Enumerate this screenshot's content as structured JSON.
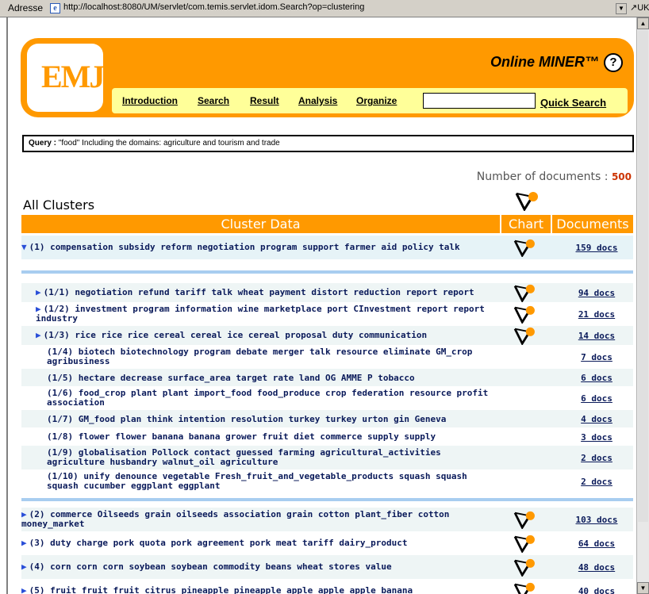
{
  "browser": {
    "address_label": "Adresse",
    "url": "http://localhost:8080/UM/servlet/com.temis.servlet.idom.Search?op=clustering",
    "go_label": "UK"
  },
  "header": {
    "logo_text": "EMJ",
    "app_title": "Online MINER™",
    "help_glyph": "?",
    "nav": [
      "Introduction",
      "Search",
      "Result",
      "Analysis",
      "Organize"
    ],
    "quick_search_placeholder": "",
    "quick_search_label": "Quick Search"
  },
  "query": {
    "label": "Query :",
    "text": " \"food\"  Including the domains: agriculture and tourism and trade"
  },
  "doc_count": {
    "label": "Number of documents : ",
    "value": "500"
  },
  "clusters_title": "All Clusters",
  "table": {
    "headers": [
      "Cluster Data",
      "Chart",
      "Documents"
    ],
    "top": {
      "arrow": "▼",
      "text": "(1) compensation subsidy reform negotiation program support farmer aid policy talk",
      "docs": "159 docs",
      "chart": true
    },
    "sub": [
      {
        "arrow": "▶",
        "text": "(1/1) negotiation refund tariff talk wheat payment distort reduction report report",
        "docs": "94 docs",
        "chart": true
      },
      {
        "arrow": "▶",
        "text": "(1/2) investment program information wine marketplace port CInvestment report report industry",
        "docs": "21 docs",
        "chart": true
      },
      {
        "arrow": "▶",
        "text": "(1/3) rice rice rice cereal cereal ice cereal proposal duty communication",
        "docs": "14 docs",
        "chart": true
      },
      {
        "arrow": "",
        "text": "(1/4) biotech biotechnology program debate merger talk resource eliminate GM_crop agribusiness",
        "docs": "7 docs",
        "chart": false
      },
      {
        "arrow": "",
        "text": "(1/5) hectare decrease surface_area target rate land OG AMME P tobacco",
        "docs": "6 docs",
        "chart": false
      },
      {
        "arrow": "",
        "text": "(1/6) food_crop plant plant import_food food_produce crop federation resource profit association",
        "docs": "6 docs",
        "chart": false
      },
      {
        "arrow": "",
        "text": "(1/7) GM_food plan think intention resolution turkey turkey urton gin Geneva",
        "docs": "4 docs",
        "chart": false
      },
      {
        "arrow": "",
        "text": "(1/8) flower flower banana banana grower fruit diet commerce supply supply",
        "docs": "3 docs",
        "chart": false
      },
      {
        "arrow": "",
        "text": "(1/9) globalisation Pollock contact guessed farming agricultural_activities agriculture husbandry walnut_oil agriculture",
        "docs": "2 docs",
        "chart": false
      },
      {
        "arrow": "",
        "text": "(1/10) unify denounce vegetable Fresh_fruit_and_vegetable_products squash squash squash cucumber eggplant eggplant",
        "docs": "2 docs",
        "chart": false
      }
    ],
    "rest": [
      {
        "arrow": "▶",
        "text": "(2) commerce Oilseeds grain oilseeds association grain cotton plant_fiber cotton money_market",
        "docs": "103 docs",
        "chart": true
      },
      {
        "arrow": "▶",
        "text": "(3) duty charge pork quota pork agreement pork meat tariff dairy_product",
        "docs": "64 docs",
        "chart": true
      },
      {
        "arrow": "▶",
        "text": "(4) corn corn corn soybean soybean commodity beans wheat stores value",
        "docs": "48 docs",
        "chart": true
      },
      {
        "arrow": "▶",
        "text": "(5) fruit fruit fruit citrus pineapple pineapple apple apple apple banana",
        "docs": "40 docs",
        "chart": true
      }
    ]
  },
  "colors": {
    "accent_orange": "#ff9900",
    "nav_yellow": "#ffff99",
    "link_navy": "#0a1a5a",
    "arrow_blue": "#2a4fd8",
    "separator_blue": "#a8cdf0"
  }
}
